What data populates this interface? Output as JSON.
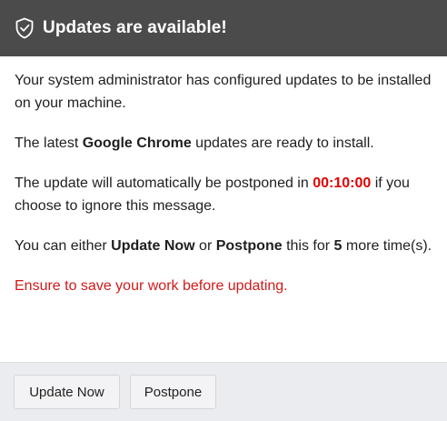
{
  "header": {
    "icon": "shield-check-icon",
    "title": "Updates are available!"
  },
  "message": {
    "line1": "Your system administrator has configured updates to be installed on your machine.",
    "line2_pre": "The latest ",
    "line2_product": "Google Chrome",
    "line2_post": " updates are ready to install.",
    "line3_pre": "The update will automatically be postponed in ",
    "line3_timer": "00:10:00",
    "line3_post": " if you choose to ignore this message.",
    "line4_pre": "You can either ",
    "line4_update": "Update Now",
    "line4_mid": " or ",
    "line4_postpone": "Postpone",
    "line4_mid2": " this for ",
    "line4_count": "5",
    "line4_post": " more time(s).",
    "warning": "Ensure to save your work before updating."
  },
  "buttons": {
    "update_now": "Update Now",
    "postpone": "Postpone"
  },
  "colors": {
    "header_bg": "#4b4b4b",
    "timer": "#e00000",
    "warning": "#d21a1a",
    "footer_bg": "#ebecef"
  }
}
